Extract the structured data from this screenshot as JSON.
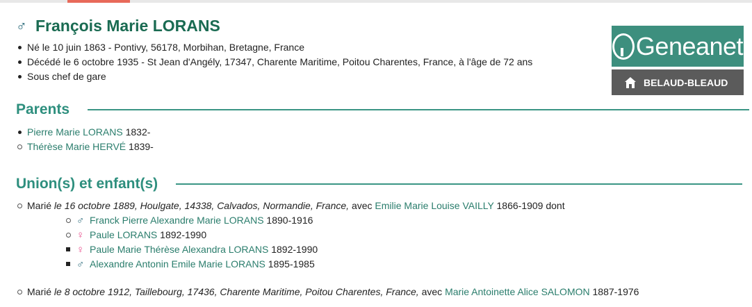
{
  "person": {
    "gender_icon": "male-symbol-icon",
    "symbol": "♂",
    "name": "François Marie LORANS",
    "facts": [
      "Né le 10 juin 1863 - Pontivy, 56178, Morbihan, Bretagne, France",
      "Décédé le 6 octobre 1935 - St Jean d'Angély, 17347, Charente Maritime, Poitou Charentes, France, à l'âge de 72 ans",
      "Sous chef de gare"
    ]
  },
  "parents": {
    "heading": "Parents",
    "items": [
      {
        "name": "Pierre Marie LORANS",
        "dates": " 1832-"
      },
      {
        "name": "Thérèse Marie HERVÉ",
        "dates": " 1839-"
      }
    ]
  },
  "unions": {
    "heading": "Union(s) et enfant(s)",
    "items": [
      {
        "prefix": "Marié ",
        "details": "le 16 octobre 1889, Houlgate, 14338, Calvados, Normandie, France,",
        "avec": " avec ",
        "spouse": "Emilie Marie Louise VAILLY",
        "spouse_dates": " 1866-1909",
        "suffix": " dont",
        "children": [
          {
            "symbol": "♂",
            "icon": "male-symbol-icon",
            "name": "Franck Pierre Alexandre Marie LORANS",
            "dates": " 1890-1916"
          },
          {
            "symbol": "♀",
            "icon": "female-symbol-icon",
            "name": "Paule LORANS",
            "dates": " 1892-1990"
          },
          {
            "symbol": "♀",
            "icon": "female-symbol-icon",
            "name": "Paule Marie Thérèse Alexandra LORANS",
            "dates": " 1892-1990"
          },
          {
            "symbol": "♂",
            "icon": "male-symbol-icon",
            "name": "Alexandre Antonin Emile Marie LORANS",
            "dates": " 1895-1985"
          }
        ]
      },
      {
        "prefix": "Marié ",
        "details": "le 8 octobre 1912, Taillebourg, 17436, Charente Maritime, Poitou Charentes, France,",
        "avec": " avec ",
        "spouse": "Marie Antoinette Alice SALOMON",
        "spouse_dates": " 1887-1976"
      }
    ]
  },
  "brand": {
    "logo_text": "Geneanet",
    "logo_icon": "tree-icon",
    "tree_owner": "BELAUD-BLEAUD",
    "home_icon": "home-icon",
    "color": "#3d8f7e"
  }
}
